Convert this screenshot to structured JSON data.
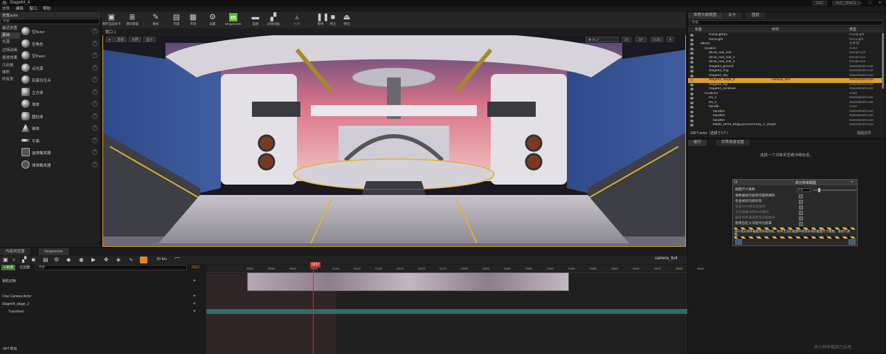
{
  "window": {
    "title": "Stage64_4",
    "menu": [
      "文件",
      "编辑",
      "窗口",
      "帮助"
    ],
    "tags": [
      "DDC",
      "RED_SPACE"
    ]
  },
  "place_panel": {
    "tab": "放置actor",
    "search_placeholder": "搜索",
    "categories": [
      "最近放置",
      "基础",
      "光源",
      "过场动画",
      "视觉效果",
      "几何体",
      "体积",
      "所有类"
    ],
    "selected_category": "基础",
    "items": [
      {
        "label": "空Actor",
        "icon": "sphere-icon"
      },
      {
        "label": "空角色",
        "icon": "character-icon"
      },
      {
        "label": "空Pawn",
        "icon": "pawn-icon"
      },
      {
        "label": "点光源",
        "icon": "point-light-icon"
      },
      {
        "label": "玩家出生点",
        "icon": "player-start-icon"
      },
      {
        "label": "立方体",
        "icon": "cube-icon"
      },
      {
        "label": "球体",
        "icon": "sphere-icon"
      },
      {
        "label": "圆柱体",
        "icon": "cylinder-icon"
      },
      {
        "label": "锥体",
        "icon": "cone-icon"
      },
      {
        "label": "平面",
        "icon": "plane-icon"
      },
      {
        "label": "盒体触发器",
        "icon": "box-trigger-icon"
      },
      {
        "label": "球体触发器",
        "icon": "sphere-trigger-icon"
      }
    ]
  },
  "toolbar": {
    "buttons": [
      {
        "label": "保存当前关卡",
        "icon": "save-icon"
      },
      {
        "label": "源码管理",
        "icon": "source-control-icon"
      },
      {
        "label": "模式",
        "icon": "modes-icon"
      },
      {
        "label": "内容",
        "icon": "content-icon"
      },
      {
        "label": "市场",
        "icon": "marketplace-icon"
      },
      {
        "label": "设置",
        "icon": "settings-icon"
      },
      {
        "label": "Megascans",
        "icon": "megascans-icon"
      },
      {
        "label": "蓝图",
        "icon": "blueprint-icon"
      },
      {
        "label": "过场动画",
        "icon": "cinematics-icon"
      },
      {
        "label": "构建",
        "icon": "build-icon"
      },
      {
        "label": "暂停",
        "icon": "pause-icon"
      },
      {
        "label": "停止",
        "icon": "stop-icon"
      },
      {
        "label": "弹出",
        "icon": "eject-icon"
      }
    ]
  },
  "viewport": {
    "tab": "视口 1",
    "left_pills": [
      "透视",
      "光照",
      "显示"
    ],
    "right_pills": [
      "10",
      "10°",
      "0.25",
      "4"
    ]
  },
  "outliner": {
    "tabs": [
      "世界大纲视图",
      "关卡",
      "图层"
    ],
    "search_placeholder": "搜索...",
    "columns": [
      "标签",
      "序列",
      "类型"
    ],
    "rows": [
      {
        "name": "PointLight15",
        "type": "PointLight",
        "indent": 3
      },
      {
        "name": "RectLight",
        "type": "RectLight",
        "indent": 3
      },
      {
        "name": "MESH",
        "type": "文件夹",
        "indent": 1
      },
      {
        "name": "location",
        "type": "Actor",
        "indent": 2
      },
      {
        "name": "decal_mat_inst",
        "type": "DecalActor",
        "indent": 3
      },
      {
        "name": "decal_mat_inst_2",
        "type": "DecalActor",
        "indent": 3
      },
      {
        "name": "decal_mat_inst_3",
        "type": "DecalActor",
        "indent": 3
      },
      {
        "name": "Stage64_ground",
        "type": "StaticMeshActor",
        "indent": 3
      },
      {
        "name": "Stage64_ring",
        "type": "StaticMeshActor",
        "indent": 3
      },
      {
        "name": "Stage64_sky",
        "type": "StaticMeshActor",
        "indent": 3
      },
      {
        "name": "Stage64_stage_2",
        "extra": "camera_fix4",
        "type": "StaticMeshActor",
        "indent": 3,
        "selected": true
      },
      {
        "name": "Stage64_top",
        "type": "StaticMeshActor",
        "indent": 3
      },
      {
        "name": "Stage64_windows",
        "type": "StaticMeshActor",
        "indent": 3
      },
      {
        "name": "location2",
        "type": "Actor",
        "indent": 2
      },
      {
        "name": "Ds_1",
        "type": "StaticMeshActor",
        "indent": 3
      },
      {
        "name": "Ds_s",
        "type": "StaticMeshActor",
        "indent": 3
      },
      {
        "name": "handle",
        "type": "Actor",
        "indent": 3
      },
      {
        "name": "handle2",
        "type": "StaticMeshActor",
        "indent": 4
      },
      {
        "name": "handle3",
        "type": "StaticMeshActor",
        "indent": 4
      },
      {
        "name": "handle4",
        "type": "StaticMeshActor",
        "indent": 4
      },
      {
        "name": "KB3D_MTM_BldgLgCornerArray_A_Dnyhl",
        "type": "StaticMeshActor",
        "indent": 4
      }
    ],
    "footer_count": "106个actor（选择了1个）",
    "view_options": "视图选项"
  },
  "details": {
    "tabs": [
      "细节",
      "世界场景设置"
    ],
    "empty_message": "选择一个对象来查看详细信息。"
  },
  "dialog": {
    "title": "高分辨率截图",
    "rows": [
      {
        "label": "截图尺寸乘数",
        "value": "2.0"
      },
      {
        "label": "将数据帧内容用作图像掩码"
      },
      {
        "label": "包含帧状内部背景"
      },
      {
        "label": "包含HDR格式的帧状"
      },
      {
        "label": "写出帧缓冲的HDR格式"
      },
      {
        "label": "缓存所有通道至无光照缓冲"
      },
      {
        "label": "使用自定义深度作为遮罩"
      }
    ],
    "warning": "由于高分辨率截图受系统限制，帧率无法在截图中获得有效的截图尺寸乘数，请进行调整。"
  },
  "sequencer": {
    "tabs": [
      "内容浏览器",
      "Sequencer"
    ],
    "fps": "30 fps",
    "add_track": "+ 轨道",
    "filter": "过滤器",
    "search_placeholder": "搜索",
    "current_frame_left": "0222",
    "playhead_frame": "0222",
    "sequence_name": "camera_fix4",
    "ruler_marks": [
      "0000",
      "0030",
      "0060",
      "0090",
      "0120",
      "0150",
      "0180",
      "0210",
      "0240",
      "0270",
      "0300",
      "0330",
      "0360",
      "0390",
      "0420",
      "0450",
      "0480",
      "0510",
      "0540",
      "0570",
      "0600",
      "0630"
    ],
    "tracks": [
      {
        "label": "相机切换"
      },
      {
        "label": "Cine Camera Actor"
      },
      {
        "label": "Stage64_stage_2"
      },
      {
        "label": "Transform"
      }
    ],
    "footer": "34个项目"
  },
  "watermark": "高分辨率截图已启用",
  "colors": {
    "selection_accent": "#d9a12c",
    "sequencer_track_teal": "#2f6e66",
    "playhead_red": "#c0392b"
  }
}
